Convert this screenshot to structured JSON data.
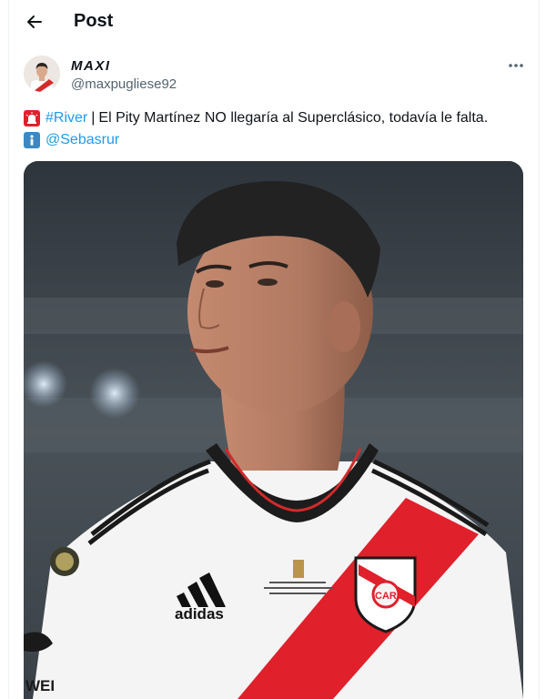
{
  "header": {
    "title": "Post",
    "back_icon": "arrow-left-icon"
  },
  "author": {
    "name": "MAXI",
    "handle": "@maxpugliese92"
  },
  "post": {
    "emoji_1": "siren-emoji",
    "hashtag": "#River",
    "separator": "|",
    "text": "El Pity Martínez NO llegaría al Superclásico, todavía le falta.",
    "emoji_2": "information-emoji",
    "mention": "@Sebasrur"
  },
  "media": {
    "jersey_brand": "adidas",
    "sponsor_partial": "WEI"
  },
  "colors": {
    "link": "#1d9bf0",
    "text": "#0f1419",
    "secondary": "#536471",
    "accent_red": "#e0202b"
  }
}
